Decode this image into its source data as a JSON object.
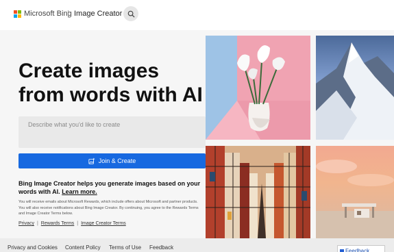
{
  "header": {
    "brand": "Microsoft Bing",
    "divider": "|",
    "product": "Image Creator",
    "search_icon": "search-icon"
  },
  "hero": {
    "title": "Create images from words with AI"
  },
  "prompt": {
    "placeholder": "Describe what you'd like to create",
    "value": ""
  },
  "join_button": {
    "label": "Join & Create",
    "icon": "sparkle-image-icon"
  },
  "info": {
    "text": "Bing Image Creator helps you generate images based on your words with AI.",
    "learn_more": "Learn more."
  },
  "fine_print": "You will receive emails about Microsoft Rewards, which include offers about Microsoft and partner products. You will also receive notifications about Bing Image Creator. By continuing, you agree to the Rewards Terms and Image Creator Terms below.",
  "legal_links": [
    {
      "label": "Privacy"
    },
    {
      "label": "Rewards Terms"
    },
    {
      "label": "Image Creator Terms"
    }
  ],
  "legal_separator": "|",
  "footer": {
    "links": [
      {
        "label": "Privacy and Cookies"
      },
      {
        "label": "Content Policy"
      },
      {
        "label": "Terms of Use"
      },
      {
        "label": "Feedback"
      }
    ],
    "feedback_button": "Feedback"
  },
  "colors": {
    "accent": "#1769e0",
    "ms_red": "#f25022",
    "ms_green": "#7fba00",
    "ms_blue": "#00a4ef",
    "ms_yellow": "#ffb900"
  }
}
